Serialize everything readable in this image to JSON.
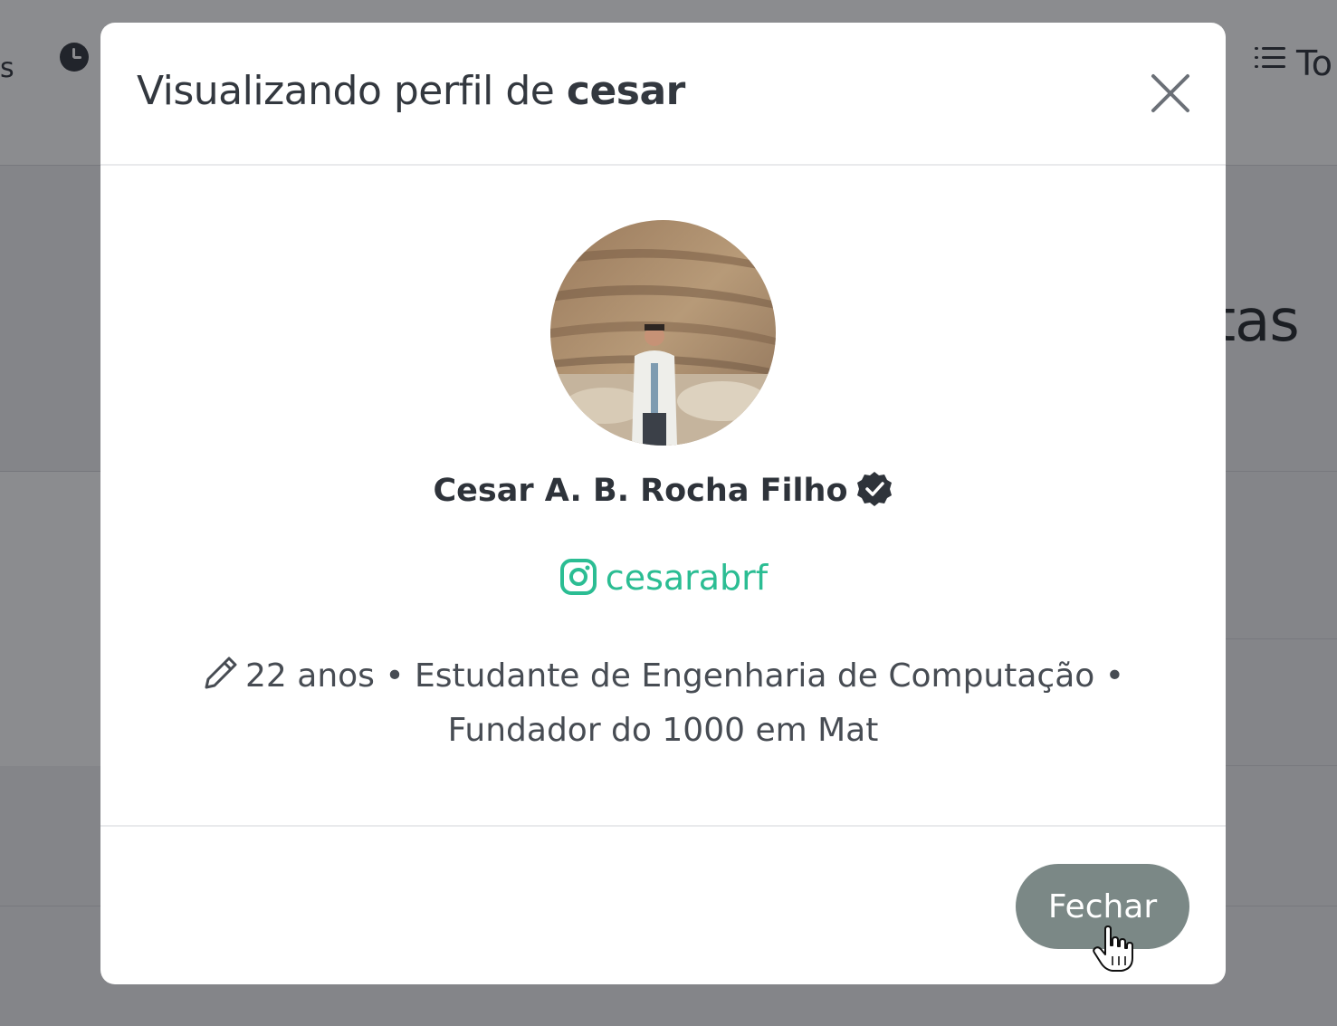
{
  "background": {
    "left_fragment": "s",
    "topright_fragment": "To",
    "heading_fragment": "tas"
  },
  "modal": {
    "title_prefix": "Visualizando perfil de ",
    "title_username": "cesar",
    "close_icon": "close-icon",
    "avatar_icon": "profile-photo",
    "full_name": "Cesar A. B. Rocha Filho",
    "verified_icon": "verified-badge-icon",
    "instagram_icon": "instagram-icon",
    "instagram_handle": "cesarabrf",
    "bio_icon": "pencil-icon",
    "bio": "22 anos • Estudante de Engenharia de Computação • Fundador do 1000 em Mat",
    "close_button_label": "Fechar"
  },
  "colors": {
    "accent_green": "#2bbd93",
    "button_gray": "#7b8886",
    "title_text": "#33383f"
  }
}
